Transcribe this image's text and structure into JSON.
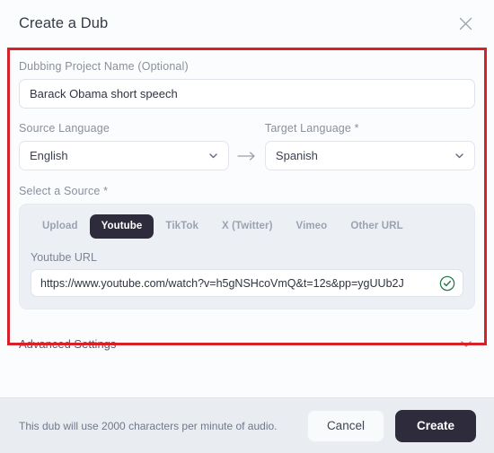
{
  "dialog": {
    "title": "Create a Dub",
    "close_icon": "close-icon"
  },
  "project": {
    "label": "Dubbing Project Name (Optional)",
    "value": "Barack Obama short speech",
    "placeholder": "Dubbing Project Name"
  },
  "languages": {
    "source_label": "Source Language",
    "source_value": "English",
    "target_label": "Target Language *",
    "target_value": "Spanish",
    "arrow_icon": "arrow-right-icon",
    "chevron_icon": "chevron-down-icon"
  },
  "source": {
    "label": "Select a Source *",
    "tabs": [
      {
        "label": "Upload",
        "active": false
      },
      {
        "label": "Youtube",
        "active": true
      },
      {
        "label": "TikTok",
        "active": false
      },
      {
        "label": "X (Twitter)",
        "active": false
      },
      {
        "label": "Vimeo",
        "active": false
      },
      {
        "label": "Other URL",
        "active": false
      }
    ],
    "url_label": "Youtube URL",
    "url_value": "https://www.youtube.com/watch?v=h5gNSHcoVmQ&t=12s&pp=ygUUb2J",
    "url_placeholder": "Youtube URL",
    "valid_icon": "check-circle-icon"
  },
  "advanced": {
    "label": "Advanced Settings",
    "chevron_icon": "chevron-down-icon"
  },
  "footer": {
    "note": "This dub will use 2000 characters per minute of audio.",
    "cancel_label": "Cancel",
    "create_label": "Create"
  },
  "colors": {
    "accent_dark": "#2e2c3c",
    "annotation_red": "#d6202a",
    "valid_green": "#2f7a4f",
    "panel_gray": "#eceff4",
    "footer_gray": "#e9edf1"
  }
}
